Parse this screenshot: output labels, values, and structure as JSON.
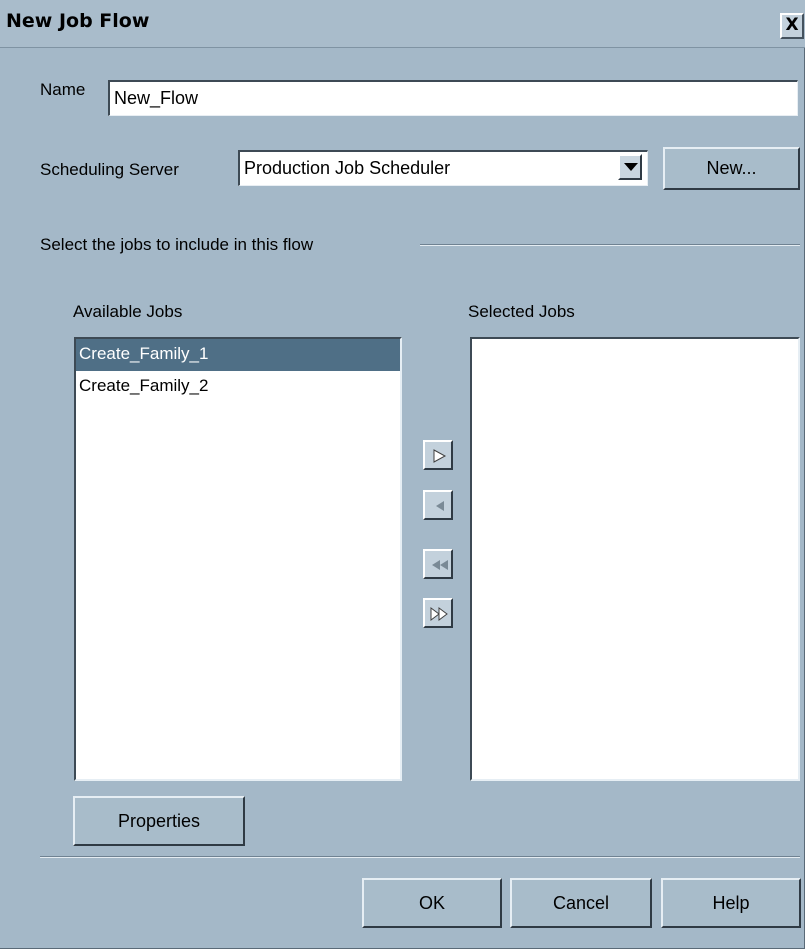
{
  "window": {
    "title": "New Job Flow",
    "close_glyph": "X"
  },
  "name_field": {
    "label": "Name",
    "value": "New_Flow"
  },
  "scheduling": {
    "label": "Scheduling Server",
    "selected": "Production Job Scheduler",
    "new_label": "New..."
  },
  "jobs_section": {
    "label": "Select the jobs to include in this flow"
  },
  "available": {
    "label": "Available Jobs",
    "items": [
      "Create_Family_1",
      "Create_Family_2"
    ],
    "selected_index": 0
  },
  "selected": {
    "label": "Selected Jobs",
    "items": []
  },
  "move_buttons": [
    "move-right-icon",
    "move-left-icon",
    "move-all-left-icon",
    "move-all-right-icon"
  ],
  "buttons": {
    "properties": "Properties",
    "ok": "OK",
    "cancel": "Cancel",
    "help": "Help"
  },
  "colors": {
    "background": "#a4b8c8",
    "selection": "#4f6f86"
  }
}
